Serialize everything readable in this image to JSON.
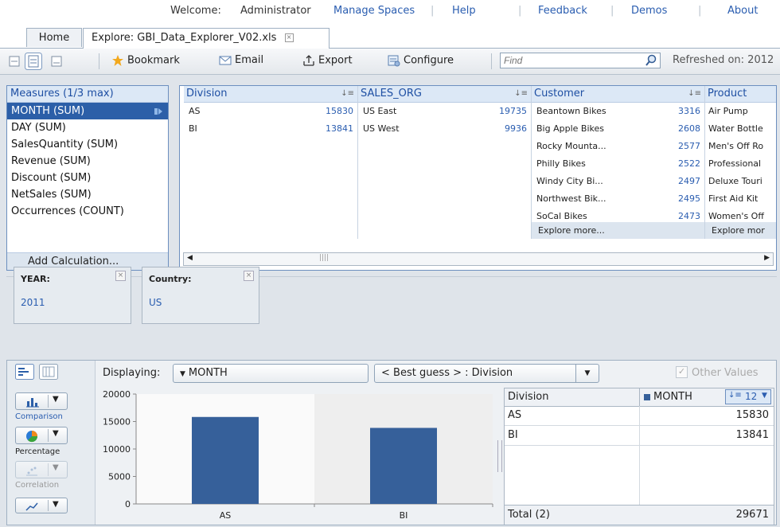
{
  "header": {
    "welcome": "Welcome:",
    "user": "Administrator",
    "links": [
      "Manage Spaces",
      "Help",
      "Feedback",
      "Demos",
      "About"
    ]
  },
  "tabs": [
    {
      "label": "Home"
    },
    {
      "label": "Explore: GBI_Data_Explorer_V02.xls"
    }
  ],
  "toolbar": {
    "bookmark": "Bookmark",
    "email": "Email",
    "export": "Export",
    "configure": "Configure",
    "find_placeholder": "Find",
    "refreshed": "Refreshed on: 2012"
  },
  "measures": {
    "title": "Measures (1/3 max)",
    "items": [
      "MONTH (SUM)",
      "DAY (SUM)",
      "SalesQuantity (SUM)",
      "Revenue (SUM)",
      "Discount (SUM)",
      "NetSales (SUM)",
      "Occurrences (COUNT)"
    ],
    "add": "Add Calculation..."
  },
  "facets": {
    "division": {
      "title": "Division",
      "rows": [
        {
          "name": "AS",
          "value": "15830"
        },
        {
          "name": "BI",
          "value": "13841"
        }
      ]
    },
    "sales_org": {
      "title": "SALES_ORG",
      "rows": [
        {
          "name": "US East",
          "value": "19735"
        },
        {
          "name": "US West",
          "value": "9936"
        }
      ]
    },
    "customer": {
      "title": "Customer",
      "rows": [
        {
          "name": "Beantown Bikes",
          "value": "3316"
        },
        {
          "name": "Big Apple Bikes",
          "value": "2608"
        },
        {
          "name": "Rocky Mounta...",
          "value": "2577"
        },
        {
          "name": "Philly Bikes",
          "value": "2522"
        },
        {
          "name": "Windy City Bi...",
          "value": "2497"
        },
        {
          "name": "Northwest Bik...",
          "value": "2495"
        },
        {
          "name": "SoCal Bikes",
          "value": "2473"
        }
      ],
      "more": "Explore more..."
    },
    "product": {
      "title": "Product",
      "rows": [
        "Air Pump",
        "Water Bottle",
        "Men's Off Ro",
        "Professional",
        "Deluxe Touri",
        "First Aid Kit",
        "Women's Off"
      ],
      "more": "Explore mor"
    }
  },
  "filters": [
    {
      "label": "YEAR:",
      "value": "2011"
    },
    {
      "label": "Country:",
      "value": "US"
    }
  ],
  "chart_types": [
    "Comparison",
    "Percentage",
    "Correlation"
  ],
  "display": {
    "label": "Displaying:",
    "measure": "MONTH",
    "dimension": "< Best guess > : Division",
    "other_values": "Other Values"
  },
  "chart_data": {
    "type": "bar",
    "categories": [
      "AS",
      "BI"
    ],
    "values": [
      15830,
      13841
    ],
    "ylim": [
      0,
      20000
    ],
    "yticks": [
      "20000",
      "15000",
      "10000",
      "5000",
      "0"
    ],
    "bar_color": "#36609a"
  },
  "table": {
    "col1": "Division",
    "col2": "MONTH",
    "count": "12",
    "rows": [
      {
        "name": "AS",
        "value": "15830"
      },
      {
        "name": "BI",
        "value": "13841"
      }
    ],
    "total_label": "Total (2)",
    "total_value": "29671"
  }
}
